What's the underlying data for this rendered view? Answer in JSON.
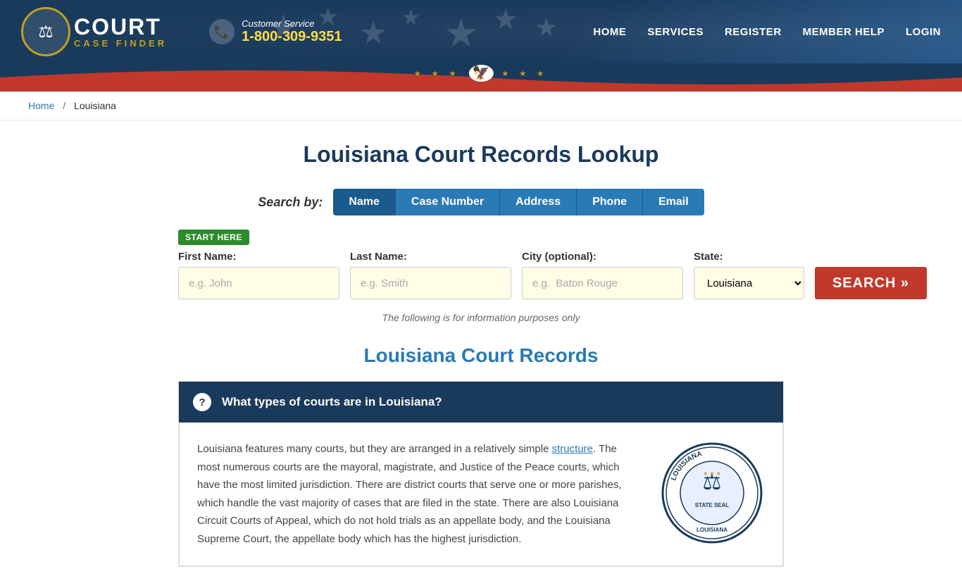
{
  "header": {
    "logo": {
      "court_text": "COURT",
      "case_finder_text": "CASE FINDER",
      "icon": "⚖"
    },
    "phone": {
      "label": "Customer Service",
      "number": "1-800-309-9351"
    },
    "nav": {
      "items": [
        {
          "label": "HOME",
          "href": "#"
        },
        {
          "label": "SERVICES",
          "href": "#"
        },
        {
          "label": "REGISTER",
          "href": "#"
        },
        {
          "label": "MEMBER HELP",
          "href": "#"
        },
        {
          "label": "LOGIN",
          "href": "#"
        }
      ]
    }
  },
  "breadcrumb": {
    "home_label": "Home",
    "separator": "/",
    "current": "Louisiana"
  },
  "main": {
    "page_title": "Louisiana Court Records Lookup",
    "search_by_label": "Search by:",
    "search_tabs": [
      {
        "label": "Name",
        "active": true
      },
      {
        "label": "Case Number",
        "active": false
      },
      {
        "label": "Address",
        "active": false
      },
      {
        "label": "Phone",
        "active": false
      },
      {
        "label": "Email",
        "active": false
      }
    ],
    "form": {
      "start_here_badge": "START HERE",
      "first_name_label": "First Name:",
      "first_name_placeholder": "e.g. John",
      "last_name_label": "Last Name:",
      "last_name_placeholder": "e.g. Smith",
      "city_label": "City (optional):",
      "city_placeholder": "e.g.  Baton Rouge",
      "state_label": "State:",
      "state_default": "Louisiana",
      "search_button": "SEARCH »"
    },
    "disclaimer": "The following is for information purposes only",
    "section_title": "Louisiana Court Records",
    "accordion": {
      "question": "What types of courts are in Louisiana?",
      "body_text": "Louisiana features many courts, but they are arranged in a relatively simple structure. The most numerous courts are the mayoral, magistrate, and Justice of the Peace courts, which have the most limited jurisdiction. There are district courts that serve one or more parishes, which handle the vast majority of cases that are filed in the state. There are also Louisiana Circuit Courts of Appeal, which do not hold trials as an appellate body, and the Louisiana Supreme Court, the appellate body which has the highest jurisdiction.",
      "structure_link": "structure"
    }
  }
}
